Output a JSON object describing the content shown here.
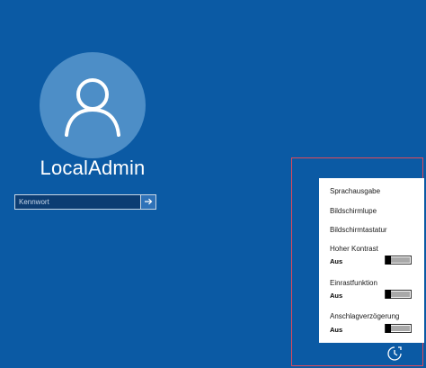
{
  "user": {
    "name": "LocalAdmin",
    "avatar_icon": "user-silhouette-icon"
  },
  "password": {
    "placeholder": "Kennwort",
    "submit_icon": "arrow-right-icon"
  },
  "accessibility_menu": {
    "items": [
      {
        "label": "Sprachausgabe"
      },
      {
        "label": "Bildschirmlupe"
      },
      {
        "label": "Bildschirmtastatur"
      }
    ],
    "toggles": [
      {
        "label": "Hoher Kontrast",
        "state": "Aus"
      },
      {
        "label": "Einrastfunktion",
        "state": "Aus"
      },
      {
        "label": "Anschlagverzögerung",
        "state": "Aus"
      }
    ]
  },
  "ease_of_access_icon": "ease-of-access-icon",
  "colors": {
    "background": "#0b5aa4",
    "avatar_circle": "#4d8ec7",
    "highlight_frame": "#e04a5a",
    "menu_background": "#ffffff"
  }
}
